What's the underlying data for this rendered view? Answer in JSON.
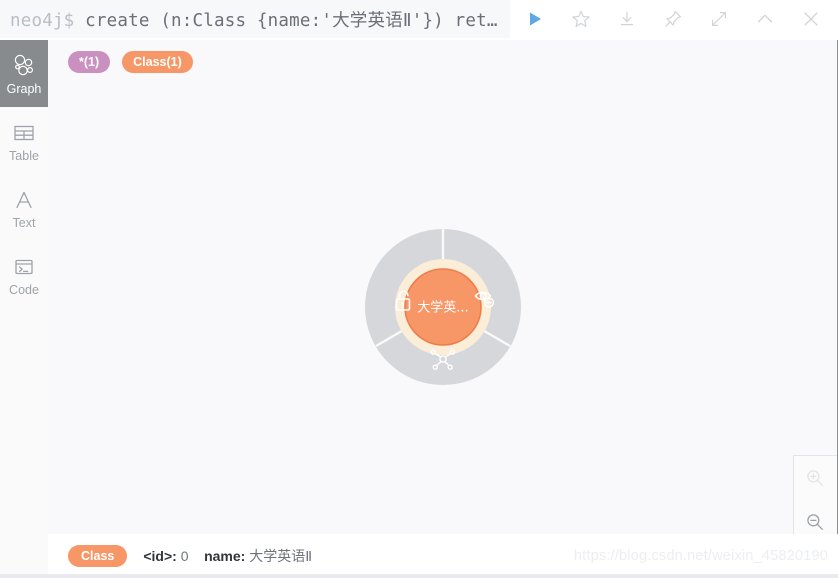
{
  "editor": {
    "prompt": "neo4j$",
    "query": "create (n:Class {name:'大学英语Ⅱ'}) ret…"
  },
  "toolbar": {
    "items": [
      {
        "name": "run-query-button",
        "label": "Run"
      },
      {
        "name": "favorite-button",
        "label": "Save as favorite"
      },
      {
        "name": "download-button",
        "label": "Download"
      },
      {
        "name": "pin-button",
        "label": "Pin"
      },
      {
        "name": "expand-button",
        "label": "Fullscreen"
      },
      {
        "name": "collapse-button",
        "label": "Collapse"
      },
      {
        "name": "close-button",
        "label": "Close"
      }
    ]
  },
  "sidebar": {
    "items": [
      {
        "label": "Graph",
        "icon": "graph-icon",
        "active": true
      },
      {
        "label": "Table",
        "icon": "table-icon",
        "active": false
      },
      {
        "label": "Text",
        "icon": "text-icon",
        "active": false
      },
      {
        "label": "Code",
        "icon": "code-icon",
        "active": false
      }
    ]
  },
  "legend": {
    "all": "*(1)",
    "label": "Class(1)",
    "colors": {
      "all": "#c990c0",
      "label": "#f79767"
    }
  },
  "graph": {
    "node": {
      "caption": "大学英...",
      "fill": "#f79767",
      "ring": "#fbeed9",
      "halo": "#d5d7da",
      "actions": [
        {
          "name": "unlock-icon",
          "position": "left"
        },
        {
          "name": "hide-node-icon",
          "position": "right"
        },
        {
          "name": "expand-relationships-icon",
          "position": "bottom"
        }
      ]
    },
    "zoom": {
      "in_label": "Zoom in",
      "out_label": "Zoom out"
    }
  },
  "status": {
    "label": "Class",
    "id_key": "<id>:",
    "id_value": "0",
    "name_key": "name:",
    "name_value": "大学英语Ⅱ"
  },
  "watermark": "https://blog.csdn.net/weixin_45820190"
}
